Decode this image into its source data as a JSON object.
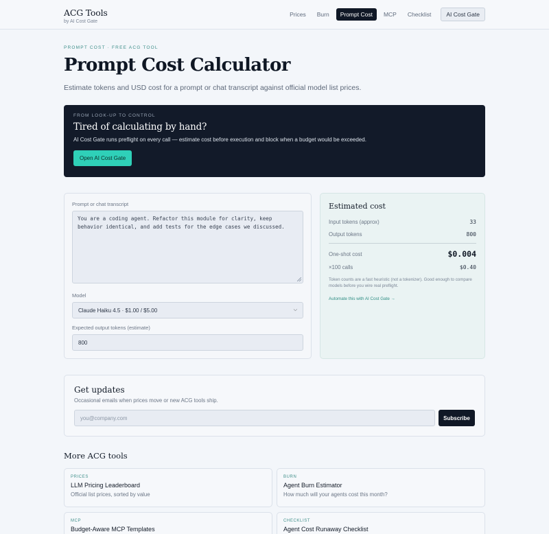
{
  "brand": {
    "title": "ACG Tools",
    "subtitle": "by AI Cost Gate"
  },
  "nav": {
    "items": [
      "Prices",
      "Burn",
      "Prompt Cost",
      "MCP",
      "Checklist"
    ],
    "active": "Prompt Cost",
    "cta": "AI Cost Gate"
  },
  "hero": {
    "eyebrow": "PROMPT COST · FREE ACG TOOL",
    "title": "Prompt Cost Calculator",
    "lede": "Estimate tokens and USD cost for a prompt or chat transcript against official model list prices."
  },
  "promo": {
    "eyebrow": "FROM LOOK-UP TO CONTROL",
    "title": "Tired of calculating by hand?",
    "text": "AI Cost Gate runs preflight on every call — estimate cost before execution and block when a budget would be exceeded.",
    "button": "Open AI Cost Gate"
  },
  "form": {
    "transcript_label": "Prompt or chat transcript",
    "transcript_value": "You are a coding agent. Refactor this module for clarity, keep behavior identical, and add tests for the edge cases we discussed.",
    "model_label": "Model",
    "model_value": "Claude Haiku 4.5 · $1.00 / $5.00",
    "output_label": "Expected output tokens (estimate)",
    "output_value": "800"
  },
  "cost": {
    "title": "Estimated cost",
    "input_label": "Input tokens (approx)",
    "input_value": "33",
    "output_label": "Output tokens",
    "output_value": "800",
    "oneshot_label": "One-shot cost",
    "oneshot_value": "$0.004",
    "calls_label": "×100 calls",
    "calls_value": "$0.40",
    "note": "Token counts are a fast heuristic (not a tokenizer). Good enough to compare models before you wire real preflight.",
    "link": "Automate this with AI Cost Gate →"
  },
  "updates": {
    "title": "Get updates",
    "subtitle": "Occasional emails when prices move or new ACG tools ship.",
    "placeholder": "you@company.com",
    "button": "Subscribe"
  },
  "more": {
    "title": "More ACG tools",
    "tools": [
      {
        "tag": "PRICES",
        "name": "LLM Pricing Leaderboard",
        "desc": "Official list prices, sorted by value"
      },
      {
        "tag": "BURN",
        "name": "Agent Burn Estimator",
        "desc": "How much will your agents cost this month?"
      },
      {
        "tag": "MCP",
        "name": "Budget-Aware MCP Templates",
        "desc": ""
      },
      {
        "tag": "CHECKLIST",
        "name": "Agent Cost Runaway Checklist",
        "desc": ""
      }
    ]
  },
  "colors": {
    "accent": "#2fd0b8",
    "dark": "#121a29",
    "teal_text": "#3f8f8a"
  }
}
